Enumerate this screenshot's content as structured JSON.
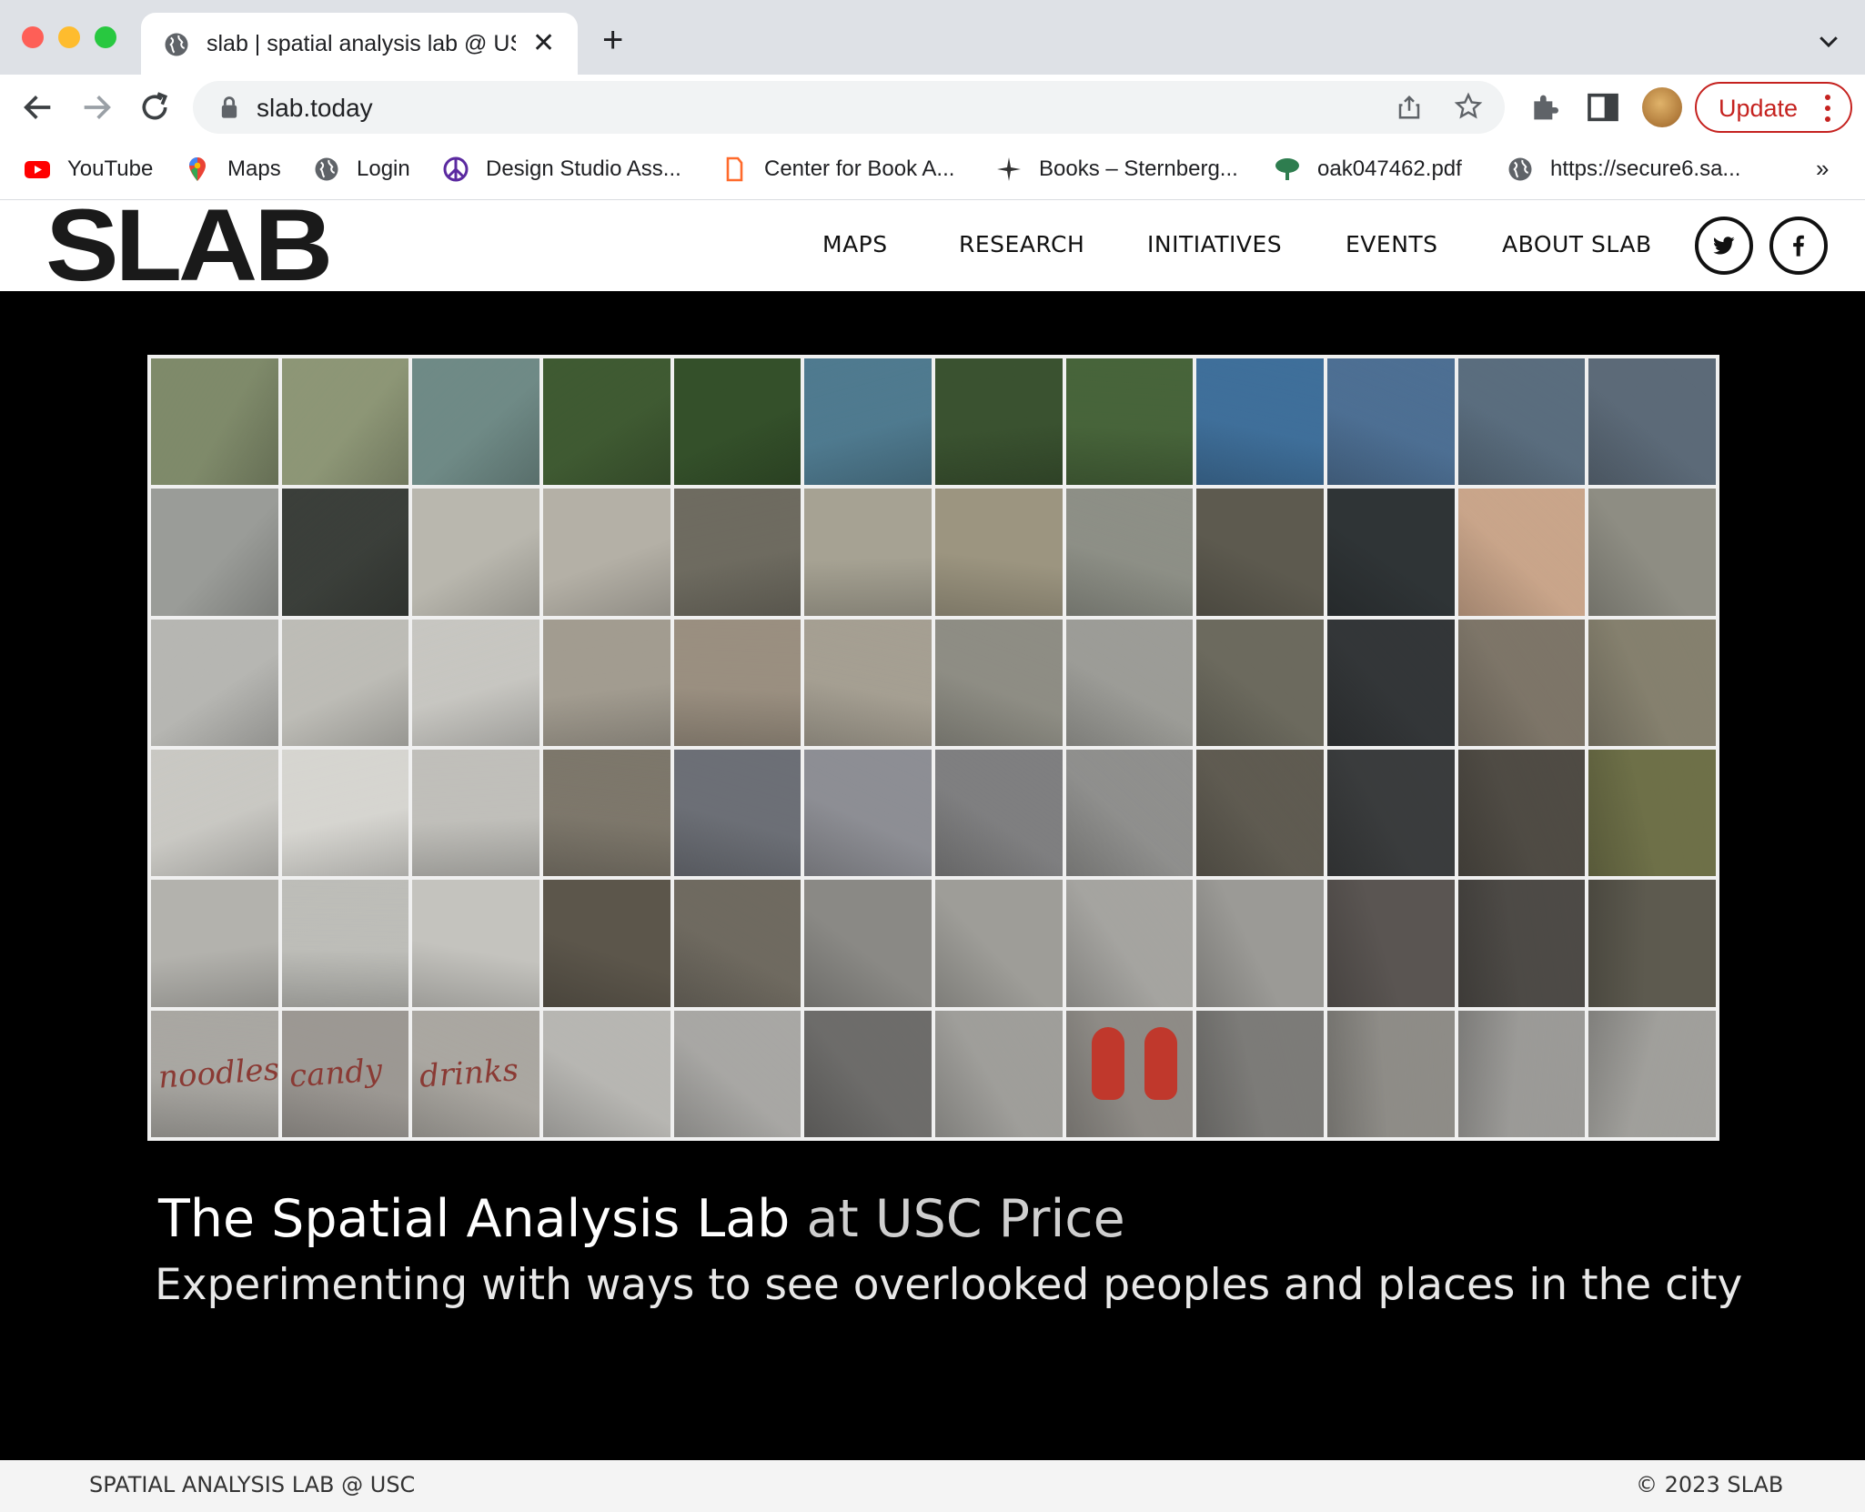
{
  "browser": {
    "tab": {
      "title": "slab | spatial analysis lab @ USC",
      "icon": "globe-icon"
    },
    "new_tab_symbol": "+",
    "close_symbol": "✕",
    "url": "slab.today",
    "update_label": "Update",
    "bookmarks": [
      {
        "label": "YouTube",
        "icon": "youtube-icon"
      },
      {
        "label": "Maps",
        "icon": "maps-pin-icon"
      },
      {
        "label": "Login",
        "icon": "globe-icon"
      },
      {
        "label": "Design Studio Ass...",
        "icon": "peace-icon"
      },
      {
        "label": "Center for Book A...",
        "icon": "bookmark-page-icon"
      },
      {
        "label": "Books – Sternberg...",
        "icon": "sparkle-icon"
      },
      {
        "label": "oak047462.pdf",
        "icon": "tree-icon"
      },
      {
        "label": "https://secure6.sa...",
        "icon": "globe-icon"
      }
    ],
    "bookmarks_overflow": "»",
    "colors": {
      "update_accent": "#c5221f",
      "tabstrip": "#dee1e6",
      "omnibox": "#f1f3f4"
    }
  },
  "site": {
    "logo": "SLAB",
    "nav": [
      "MAPS",
      "RESEARCH",
      "INITIATIVES",
      "EVENTS",
      "ABOUT SLAB"
    ],
    "social": [
      "twitter-icon",
      "facebook-icon"
    ],
    "hero": {
      "mosaic_words": [
        "noodles",
        "candy",
        "drinks"
      ],
      "headline_main": "The Spatial Analysis Lab",
      "headline_accent": " at USC Price",
      "tagline": "Experimenting with ways to see overlooked peoples and places in the city"
    },
    "footer": {
      "left": "SPATIAL ANALYSIS LAB @ USC",
      "right": "© 2023 SLAB"
    }
  }
}
